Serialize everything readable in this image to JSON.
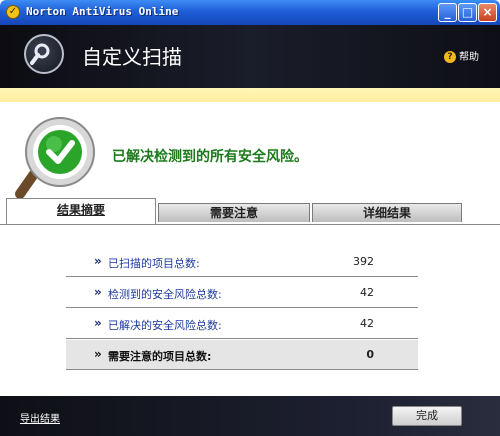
{
  "window": {
    "title": "Norton AntiVirus Online"
  },
  "header": {
    "title": "自定义扫描",
    "help_label": "帮助"
  },
  "result": {
    "message": "已解决检测到的所有安全风险。"
  },
  "tabs": [
    {
      "label": "结果摘要",
      "active": true
    },
    {
      "label": "需要注意",
      "active": false
    },
    {
      "label": "详细结果",
      "active": false
    }
  ],
  "summary": {
    "bullet": "»",
    "rows": [
      {
        "label": "已扫描的项目总数:",
        "value": "392"
      },
      {
        "label": "检测到的安全风险总数:",
        "value": "42"
      },
      {
        "label": "已解决的安全风险总数:",
        "value": "42"
      },
      {
        "label": "需要注意的项目总数:",
        "value": "0"
      }
    ]
  },
  "footer": {
    "export_label": "导出结果",
    "ok_label": "完成"
  },
  "icons": {
    "app": "norton-logo-icon",
    "scan": "magnifier-icon",
    "result": "green-check-magnifier-icon",
    "help": "help-icon"
  },
  "colors": {
    "titlebar": "#2460d6",
    "header_bg": "#14161f",
    "result_text": "#1c7a1c",
    "link_text": "#1d3a9c",
    "yellow_strip": "#fff3a8"
  }
}
